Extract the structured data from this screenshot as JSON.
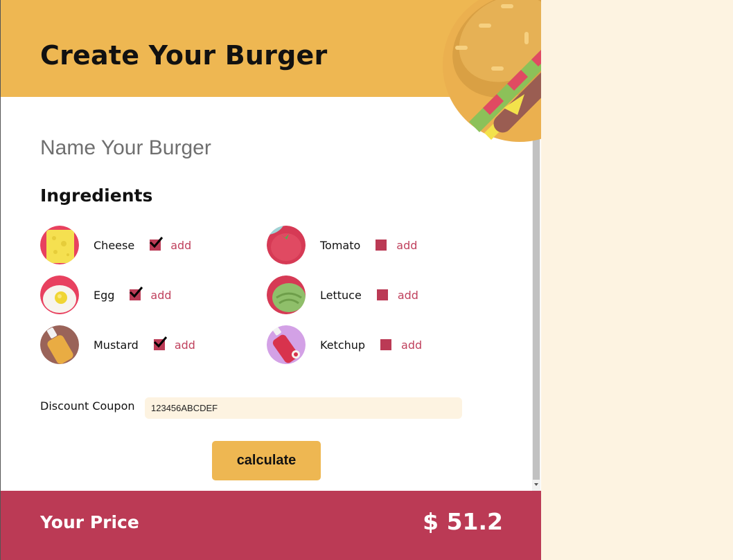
{
  "header": {
    "title": "Create Your Burger",
    "burger_icon": "burger-illustration"
  },
  "form": {
    "name_placeholder": "Name Your Burger",
    "ingredients_title": "Ingredients",
    "ingredients": [
      {
        "name": "Cheese",
        "checked": true,
        "add_label": "add",
        "icon": "cheese-icon"
      },
      {
        "name": "Tomato",
        "checked": false,
        "add_label": "add",
        "icon": "tomato-icon"
      },
      {
        "name": "Egg",
        "checked": true,
        "add_label": "add",
        "icon": "egg-icon"
      },
      {
        "name": "Lettuce",
        "checked": false,
        "add_label": "add",
        "icon": "lettuce-icon"
      },
      {
        "name": "Mustard",
        "checked": true,
        "add_label": "add",
        "icon": "mustard-icon"
      },
      {
        "name": "Ketchup",
        "checked": false,
        "add_label": "add",
        "icon": "ketchup-icon"
      }
    ],
    "coupon_label": "Discount Coupon",
    "coupon_value": "123456ABCDEF",
    "calculate_label": "calculate"
  },
  "footer": {
    "price_label": "Your Price",
    "price_value": "$ 51.2"
  },
  "colors": {
    "accent_yellow": "#eeb752",
    "accent_red": "#bb3a55",
    "page_bg": "#fdf3e1"
  }
}
